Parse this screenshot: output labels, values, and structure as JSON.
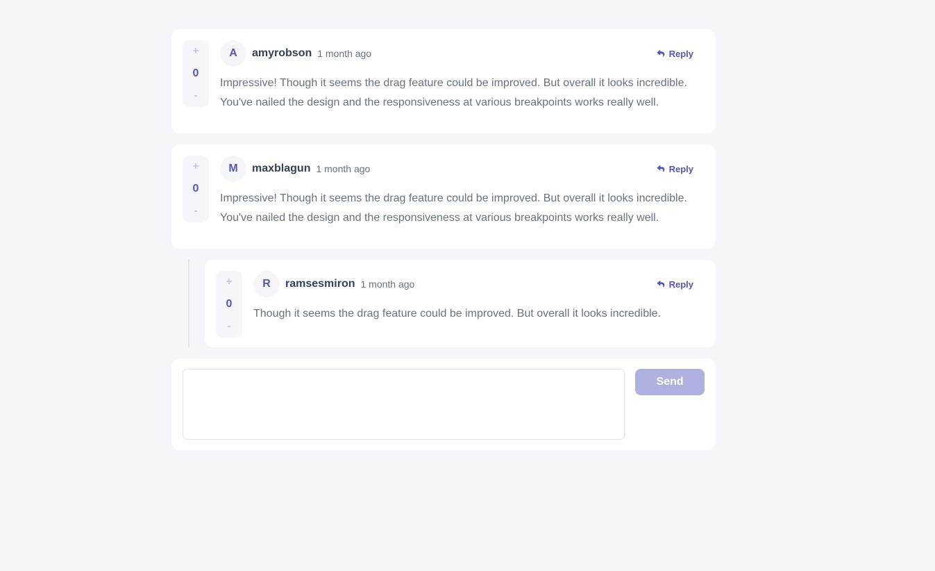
{
  "comments": [
    {
      "avatar": "A",
      "username": "amyrobson",
      "time": "1 month ago",
      "score": "0",
      "upvote": "+",
      "downvote": "-",
      "reply_label": "Reply",
      "text": "Impressive! Though it seems the drag feature could be improved. But overall it looks incredible. You've nailed the design and the responsiveness at various breakpoints works really well."
    },
    {
      "avatar": "M",
      "username": "maxblagun",
      "time": "1 month ago",
      "score": "0",
      "upvote": "+",
      "downvote": "-",
      "reply_label": "Reply",
      "text": "Impressive! Though it seems the drag feature could be improved. But overall it looks incredible. You've nailed the design and the responsiveness at various breakpoints works really well."
    },
    {
      "avatar": "R",
      "username": "ramsesmiron",
      "time": "1 month ago",
      "score": "0",
      "upvote": "+",
      "downvote": "-",
      "reply_label": "Reply",
      "text": "Though it seems the drag feature could be improved. But overall it looks incredible."
    }
  ],
  "form": {
    "placeholder": "",
    "send_label": "Send"
  },
  "colors": {
    "accent": "#5457b6",
    "accent_light": "#c3c4ef",
    "send_disabled": "#aeb0e0",
    "background": "#f5f6fa"
  }
}
